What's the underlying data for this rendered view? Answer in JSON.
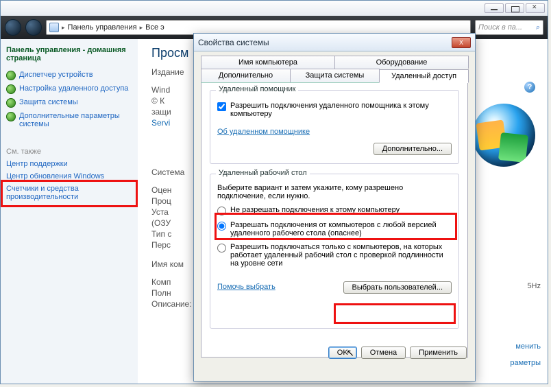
{
  "window": {
    "min_btn": "",
    "max_btn": "",
    "close_btn": ""
  },
  "nav": {
    "breadcrumb1": "Панель управления",
    "breadcrumb2": "Все э",
    "breadcrumb3": "",
    "search_placeholder": "Поиск в па..."
  },
  "sidebar": {
    "home": "Панель управления - домашняя страница",
    "items": [
      {
        "label": "Диспетчер устройств"
      },
      {
        "label": "Настройка удаленного доступа"
      },
      {
        "label": "Защита системы"
      },
      {
        "label": "Дополнительные параметры системы"
      }
    ],
    "see_also_title": "См. также",
    "see_also": [
      {
        "label": "Центр поддержки"
      },
      {
        "label": "Центр обновления Windows"
      },
      {
        "label": "Счетчики и средства производительности"
      }
    ]
  },
  "main": {
    "title": "Просм",
    "izdanie": "Издание",
    "win": "Wind",
    "copy": "© К",
    "prot": "защи",
    "serv": "Servi",
    "system": "Система",
    "ocen": "Оцен",
    "proc": "Проц",
    "ram": "Уста",
    "ozu": "(ОЗУ",
    "tip": "Тип с",
    "pero": "Перс",
    "imya": "Имя ком",
    "komp": "Комп",
    "poln": "Полн",
    "opis": "Описание:",
    "ghz_note": "5Hz",
    "change": "менить",
    "params": "раметры",
    "help": "?"
  },
  "dialog": {
    "title": "Свойства системы",
    "close": "X",
    "tabs_row1": [
      "Имя компьютера",
      "Оборудование"
    ],
    "tabs_row2": [
      "Дополнительно",
      "Защита системы",
      "Удаленный доступ"
    ],
    "remote_assist": {
      "group_title": "Удаленный помощник",
      "allow": "Разрешить подключения удаленного помощника к этому компьютеру",
      "about_link": "Об удаленном помощнике",
      "advanced_btn": "Дополнительно..."
    },
    "remote_desktop": {
      "group_title": "Удаленный рабочий стол",
      "instruction": "Выберите вариант и затем укажите, кому разрешено подключение, если нужно.",
      "opt1": "Не разрешать подключения к этому компьютеру",
      "opt2": "Разрешать подключения от компьютеров с любой версией удаленного рабочего стола (опаснее)",
      "opt3": "Разрешить подключаться только с компьютеров, на которых работает удаленный рабочий стол с проверкой подлинности на уровне сети",
      "help_choose": "Помочь выбрать",
      "select_users": "Выбрать пользователей..."
    },
    "ok": "OK",
    "cancel": "Отмена",
    "apply": "Применить"
  }
}
